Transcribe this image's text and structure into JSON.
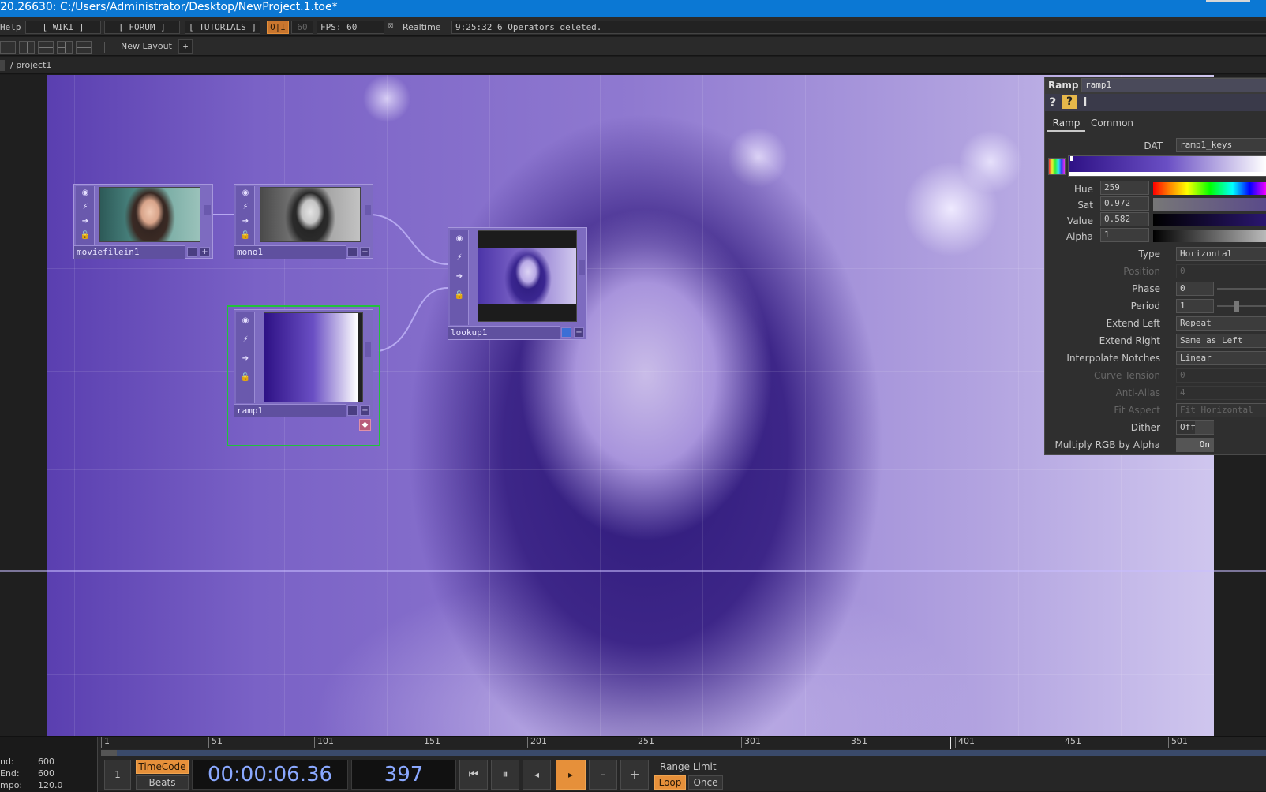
{
  "titlebar": {
    "title": "20.26630: C:/Users/Administrator/Desktop/NewProject.1.toe*"
  },
  "menubar": {
    "help": "Help",
    "wiki": "[ WIKI ]",
    "forum": "[ FORUM ]",
    "tutorials": "[ TUTORIALS ]",
    "oi": "O|I",
    "fps_target": "60",
    "fps": "FPS:  60",
    "realtime": "Realtime",
    "status": "9:25:32 6 Operators deleted."
  },
  "layoutbar": {
    "new_layout": "New Layout",
    "add": "+"
  },
  "pathbar": {
    "path": "/ project1"
  },
  "nodes": {
    "moviefilein": {
      "label": "moviefilein1"
    },
    "mono": {
      "label": "mono1"
    },
    "ramp": {
      "label": "ramp1"
    },
    "lookup": {
      "label": "lookup1"
    }
  },
  "panel": {
    "op_type": "Ramp",
    "op_name": "ramp1",
    "help_icons": [
      "?",
      "?",
      "i"
    ],
    "tabs": [
      "Ramp",
      "Common"
    ],
    "dat_label": "DAT",
    "dat_value": "ramp1_keys",
    "hue_label": "Hue",
    "hue_value": "259",
    "sat_label": "Sat",
    "sat_value": "0.972",
    "value_label": "Value",
    "value_value": "0.582",
    "alpha_label": "Alpha",
    "alpha_value": "1",
    "params": [
      {
        "label": "Type",
        "value": "Horizontal",
        "dim": false
      },
      {
        "label": "Position",
        "value": "0",
        "dim": true
      },
      {
        "label": "Phase",
        "value": "0",
        "dim": false
      },
      {
        "label": "Period",
        "value": "1",
        "dim": false
      },
      {
        "label": "Extend Left",
        "value": "Repeat",
        "dim": false
      },
      {
        "label": "Extend Right",
        "value": "Same as Left",
        "dim": false
      },
      {
        "label": "Interpolate Notches",
        "value": "Linear",
        "dim": false
      },
      {
        "label": "Curve Tension",
        "value": "0",
        "dim": true
      },
      {
        "label": "Anti-Alias",
        "value": "4",
        "dim": true
      },
      {
        "label": "Fit Aspect",
        "value": "Fit Horizontal",
        "dim": true
      },
      {
        "label": "Dither",
        "value": "Off",
        "dim": false
      },
      {
        "label": "Multiply RGB by Alpha",
        "value": "On",
        "dim": false
      }
    ]
  },
  "timeline": {
    "ruler": [
      "1",
      "51",
      "101",
      "151",
      "201",
      "251",
      "301",
      "351",
      "401",
      "451",
      "501"
    ],
    "end_label": "nd:",
    "end_value": "600",
    "rend_label": "End:",
    "rend_value": "600",
    "tempo_label": "mpo:",
    "tempo_value": "120.0",
    "one": "1",
    "timecode": "TimeCode",
    "beats": "Beats",
    "time": "00:00:06.36",
    "frame": "397",
    "minus": "-",
    "plus": "+",
    "range_limit": "Range Limit",
    "loop": "Loop",
    "once": "Once"
  },
  "colors": {
    "accent": "#e6903a",
    "title_bar": "#0b78d4",
    "selected_node": "#22c23a"
  }
}
